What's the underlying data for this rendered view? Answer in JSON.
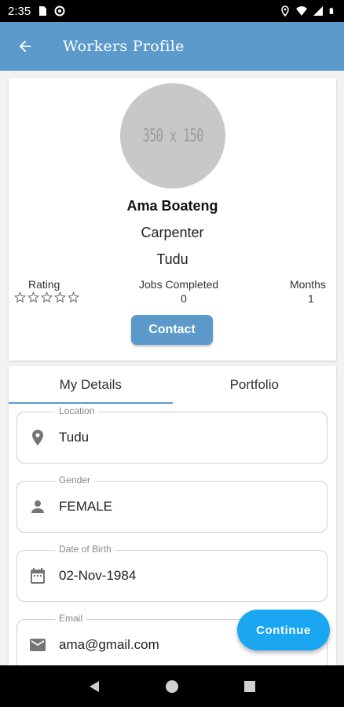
{
  "status_bar": {
    "time": "2:35",
    "icons": [
      "sim-card-icon",
      "no-disturb-icon",
      "location-icon",
      "wifi-icon",
      "signal-icon",
      "battery-icon"
    ]
  },
  "app_bar": {
    "title": "Workers Profile",
    "back_icon": "arrow-left-icon",
    "color": "#5b9acb"
  },
  "profile": {
    "avatar_placeholder": "350 x 150",
    "name": "Ama Boateng",
    "occupation": "Carpenter",
    "location": "Tudu",
    "stats": {
      "rating_label": "Rating",
      "rating_stars": 0,
      "rating_max": 5,
      "jobs_label": "Jobs Completed",
      "jobs_value": "0",
      "months_label": "Months",
      "months_value": "1"
    },
    "contact_label": "Contact"
  },
  "tabs": [
    {
      "label": "My Details",
      "active": true
    },
    {
      "label": "Portfolio",
      "active": false
    }
  ],
  "details": {
    "location": {
      "label": "Location",
      "value": "Tudu",
      "icon": "location-pin-icon"
    },
    "gender": {
      "label": "Gender",
      "value": "FEMALE",
      "icon": "person-icon"
    },
    "dob": {
      "label": "Date of Birth",
      "value": "02-Nov-1984",
      "icon": "calendar-icon"
    },
    "email": {
      "label": "Email",
      "value": "ama@gmail.com",
      "icon": "mail-icon"
    }
  },
  "fab": {
    "label": "Continue",
    "color": "#1aa6f0"
  },
  "nav_bar": {
    "buttons": [
      "back-triangle-icon",
      "home-circle-icon",
      "recents-square-icon"
    ]
  }
}
